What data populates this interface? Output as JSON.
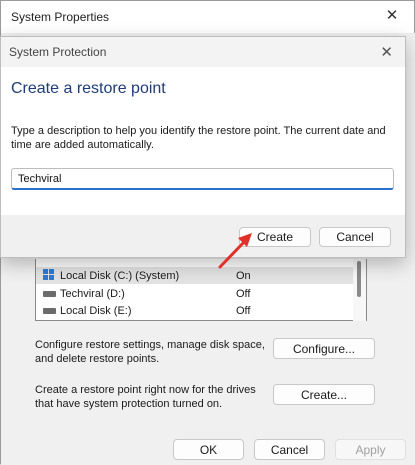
{
  "system_properties": {
    "title": "System Properties",
    "drives": [
      {
        "name": "Local Disk (C:) (System)",
        "status": "On",
        "icon": "system-drive-icon",
        "selected": true
      },
      {
        "name": "Techviral (D:)",
        "status": "Off",
        "icon": "disk-drive-icon",
        "selected": false
      },
      {
        "name": "Local Disk (E:)",
        "status": "Off",
        "icon": "disk-drive-icon",
        "selected": false
      }
    ],
    "configure_text": "Configure restore settings, manage disk space, and delete restore points.",
    "configure_button": "Configure...",
    "create_text": "Create a restore point right now for the drives that have system protection turned on.",
    "create_button": "Create...",
    "ok_button": "OK",
    "cancel_button": "Cancel",
    "apply_button": "Apply"
  },
  "system_protection": {
    "title": "System Protection",
    "heading": "Create a restore point",
    "description": "Type a description to help you identify the restore point. The current date and time are added automatically.",
    "input_value": "Techviral",
    "create_button": "Create",
    "cancel_button": "Cancel"
  },
  "colors": {
    "heading": "#1f3c7a",
    "input_focus": "#2b6fd0",
    "arrow": "#e0312b"
  }
}
